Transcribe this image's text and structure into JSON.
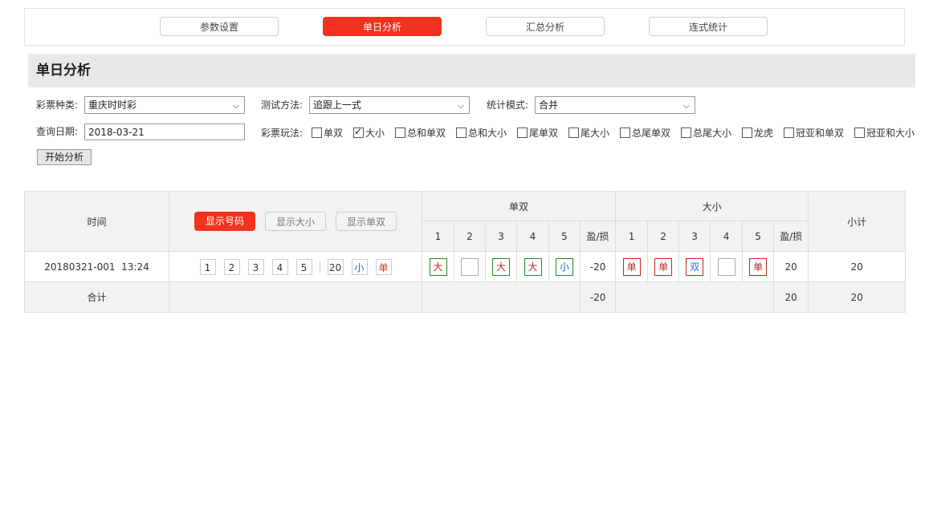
{
  "tabs": [
    {
      "label": "参数设置",
      "active": false
    },
    {
      "label": "单日分析",
      "active": true
    },
    {
      "label": "汇总分析",
      "active": false
    },
    {
      "label": "连式统计",
      "active": false
    }
  ],
  "section": {
    "title": "单日分析"
  },
  "form": {
    "lottery_label": "彩票种类:",
    "lottery_value": "重庆时时彩",
    "method_label": "测试方法:",
    "method_value": "追跟上一式",
    "mode_label": "统计模式:",
    "mode_value": "合并",
    "date_label": "查询日期:",
    "date_value": "2018-03-21",
    "play_label": "彩票玩法:",
    "plays": [
      {
        "label": "单双",
        "checked": false
      },
      {
        "label": "大小",
        "checked": true
      },
      {
        "label": "总和单双",
        "checked": false
      },
      {
        "label": "总和大小",
        "checked": false
      },
      {
        "label": "尾单双",
        "checked": false
      },
      {
        "label": "尾大小",
        "checked": false
      },
      {
        "label": "总尾单双",
        "checked": false
      },
      {
        "label": "总尾大小",
        "checked": false
      },
      {
        "label": "龙虎",
        "checked": false
      },
      {
        "label": "冠亚和单双",
        "checked": false
      },
      {
        "label": "冠亚和大小",
        "checked": false
      }
    ],
    "start_button": "开始分析"
  },
  "table": {
    "col_time": "时间",
    "btn_show_numbers": "显示号码",
    "btn_show_bigsmall": "显示大小",
    "btn_show_oddeven": "显示单双",
    "group_oddeven": "单双",
    "group_bigsmall": "大小",
    "col_subtotal": "小计",
    "sub_cols": [
      "1",
      "2",
      "3",
      "4",
      "5"
    ],
    "col_pl": "盈/损",
    "row": {
      "time": "20180321-001  13:24",
      "numbers": [
        "1",
        "2",
        "3",
        "4",
        "5"
      ],
      "sum": "20",
      "size": "小",
      "parity": "单",
      "oddeven_tags": [
        "大",
        "",
        "大",
        "大",
        "小"
      ],
      "oddeven_pl": "-20",
      "bigsmall_tags": [
        "单",
        "单",
        "双",
        "",
        "单"
      ],
      "bigsmall_pl": "20",
      "subtotal": "20"
    },
    "total": {
      "label": "合计",
      "oddeven_pl": "-20",
      "bigsmall_pl": "20",
      "subtotal": "20"
    }
  },
  "colors": {
    "accent": "#f0321e",
    "green": "#1f8b2a",
    "blue": "#1a6fd0"
  }
}
